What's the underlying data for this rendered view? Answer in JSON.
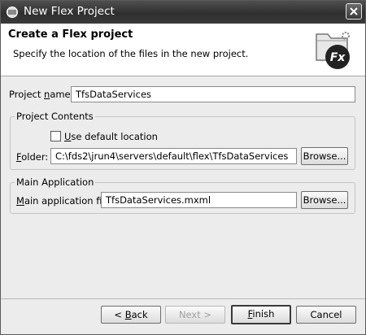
{
  "window": {
    "title": "New Flex Project"
  },
  "header": {
    "title": "Create a Flex project",
    "subtitle": "Specify the location of the files in the new project."
  },
  "project_name": {
    "label_mnemonic": "n",
    "label_pre": "Project ",
    "label_post": "ame:",
    "value": "TfsDataServices"
  },
  "project_contents": {
    "group_title": "Project Contents",
    "use_default": {
      "label_mnemonic": "U",
      "label_rest": "se default location",
      "checked": false
    },
    "folder": {
      "label_mnemonic": "F",
      "label_rest": "older:",
      "value": "C:\\fds2\\jrun4\\servers\\default\\flex\\TfsDataServices",
      "browse_label": "Browse..."
    }
  },
  "main_application": {
    "group_title": "Main Application",
    "file": {
      "label_mnemonic": "M",
      "label_rest": "ain application file:",
      "value": "TfsDataServices.mxml",
      "browse_label": "Browse..."
    }
  },
  "footer": {
    "back_mnemonic": "B",
    "back_pre": "< ",
    "back_post": "ack",
    "next_label": "Next >",
    "finish_mnemonic": "F",
    "finish_rest": "inish",
    "cancel_label": "Cancel"
  }
}
